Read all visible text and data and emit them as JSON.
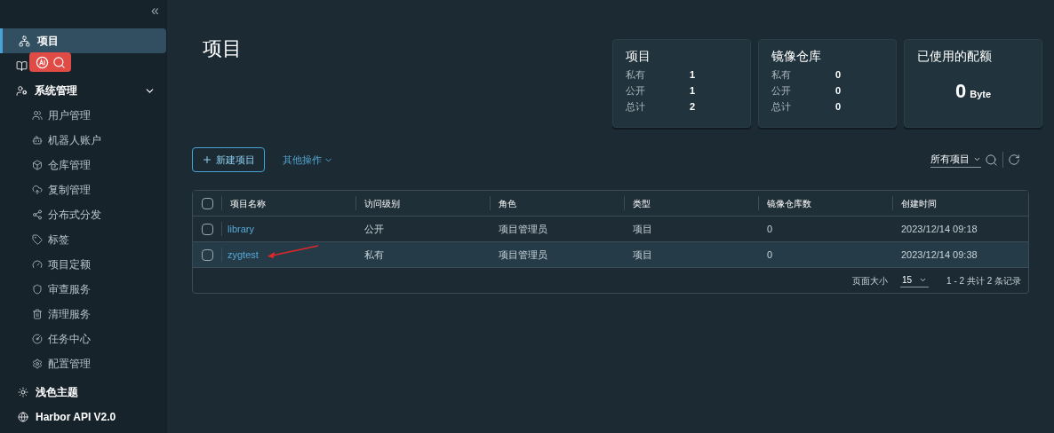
{
  "sidebar": {
    "collapse_glyph": "«",
    "items": [
      {
        "kind": "top",
        "label": "项目",
        "selected": true
      },
      {
        "kind": "covered",
        "selected": false
      },
      {
        "kind": "group",
        "label": "系统管理",
        "expanded": true,
        "children": [
          {
            "label": "用户管理",
            "selected": false
          },
          {
            "label": "机器人账户",
            "selected": false
          },
          {
            "label": "仓库管理",
            "selected": false
          },
          {
            "label": "复制管理",
            "selected": false
          },
          {
            "label": "分布式分发",
            "selected": false
          },
          {
            "label": "标签",
            "selected": false
          },
          {
            "label": "项目定额",
            "selected": false
          },
          {
            "label": "审查服务",
            "selected": false
          },
          {
            "label": "清理服务",
            "selected": false
          },
          {
            "label": "任务中心",
            "selected": false
          },
          {
            "label": "配置管理",
            "selected": false
          }
        ]
      }
    ],
    "footer": [
      {
        "label": "浅色主题"
      },
      {
        "label": "Harbor API V2.0"
      }
    ]
  },
  "title": "项目",
  "cards": [
    {
      "kind": "stats",
      "title": "项目",
      "rows": [
        {
          "label": "私有",
          "value": "1"
        },
        {
          "label": "公开",
          "value": "1"
        },
        {
          "label": "总计",
          "value": "2"
        }
      ]
    },
    {
      "kind": "stats",
      "title": "镜像仓库",
      "rows": [
        {
          "label": "私有",
          "value": "0"
        },
        {
          "label": "公开",
          "value": "0"
        },
        {
          "label": "总计",
          "value": "0"
        }
      ]
    },
    {
      "kind": "quota",
      "title": "已使用的配额",
      "value": "0",
      "unit": "Byte"
    }
  ],
  "toolbar": {
    "new_button": "新建项目",
    "more_button": "其他操作",
    "filter": "所有项目"
  },
  "table": {
    "select_all_checked": false,
    "columns": [
      "项目名称",
      "访问级别",
      "角色",
      "类型",
      "镜像仓库数",
      "创建时间"
    ],
    "rows": [
      {
        "name": "library",
        "access": "公开",
        "role": "项目管理员",
        "type": "项目",
        "repos": "0",
        "created": "2023/12/14 09:18",
        "checked": false,
        "selected": false
      },
      {
        "name": "zygtest",
        "access": "私有",
        "role": "项目管理员",
        "type": "项目",
        "repos": "0",
        "created": "2023/12/14 09:38",
        "checked": false,
        "selected": true,
        "annotated": true
      }
    ],
    "footer": {
      "page_size_label": "页面大小",
      "page_size": "15",
      "summary": "1 - 2 共计 2 条记录"
    }
  }
}
